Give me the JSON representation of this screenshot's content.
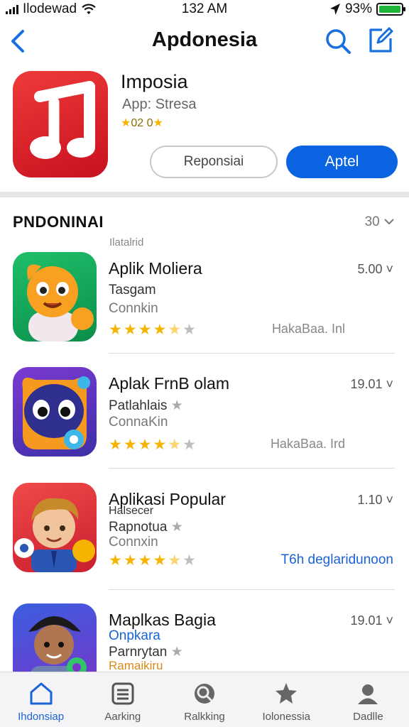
{
  "status_bar": {
    "carrier": "Ilodewad",
    "time": "132 AM",
    "battery": "93%"
  },
  "nav": {
    "title": "Apdonesia",
    "icons": [
      "back-chevron-icon",
      "search-icon",
      "compose-icon"
    ]
  },
  "featured": {
    "name": "Imposia",
    "subtitle": "App: Stresa",
    "rating_text": "02 0",
    "secondary_button": "Reponsiai",
    "primary_button": "Aptel"
  },
  "section": {
    "title": "PNDONINAI",
    "count": "30",
    "subtitle": "Ilatalrid"
  },
  "apps": [
    {
      "name": "Aplik Moliera",
      "line1": "Tasgam",
      "line2": "Connkin",
      "price": "5.00",
      "rating": 4.5,
      "meta": "HakaBaa. Inl"
    },
    {
      "name": "Aplak FrnB olam",
      "line1": "Patlahlais",
      "line2": "ConnaKin",
      "price": "19.01",
      "rating": 4.5,
      "meta": "HakaBaa. Ird"
    },
    {
      "name": "Aplikasi Popular",
      "line0": "Halsecer",
      "line1": "Rapnotua",
      "line2": "Connxin",
      "price": "1.10",
      "rating": 4.5,
      "meta": "T6h deglaridunoon"
    },
    {
      "name": "Maplkas Bagia",
      "line0": "Onpkara",
      "line1": "Parnrytan",
      "line2": "Ramaikiru",
      "price": "19.01"
    }
  ],
  "tabs": [
    {
      "label": "Ihdonsiap",
      "icon": "house-icon",
      "active": true
    },
    {
      "label": "Aarking",
      "icon": "list-icon",
      "active": false
    },
    {
      "label": "Ralkking",
      "icon": "search-icon",
      "active": false
    },
    {
      "label": "Iolonessia",
      "icon": "star-icon",
      "active": false
    },
    {
      "label": "Dadlle",
      "icon": "person-icon",
      "active": false
    }
  ],
  "colors": {
    "accent": "#0a63e0",
    "star": "#f4b400",
    "hero_icon": "#d81e29"
  }
}
